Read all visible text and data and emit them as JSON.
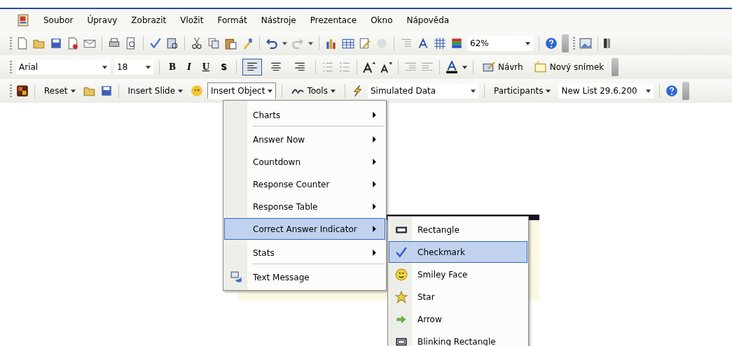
{
  "menu_bar": {
    "items": [
      {
        "label": "Soubor"
      },
      {
        "label": "Úpravy"
      },
      {
        "label": "Zobrazit"
      },
      {
        "label": "Vložit"
      },
      {
        "label": "Formát"
      },
      {
        "label": "Nástroje"
      },
      {
        "label": "Prezentace"
      },
      {
        "label": "Okno"
      },
      {
        "label": "Nápověda"
      }
    ]
  },
  "standard_toolbar": {
    "zoom": "62%"
  },
  "formatting_toolbar": {
    "font": "Arial",
    "font_size": "18",
    "styles": [
      {
        "label": "B",
        "kind": "bold",
        "pressed": false
      },
      {
        "label": "I",
        "kind": "italic",
        "pressed": false
      },
      {
        "label": "U",
        "kind": "underline",
        "pressed": false
      },
      {
        "label": "S",
        "kind": "shadow",
        "pressed": false
      }
    ],
    "alignment": [
      {
        "selected": true
      },
      {
        "selected": false
      },
      {
        "selected": false
      }
    ],
    "buttons": [
      {
        "label": "Návrh",
        "kind": "design"
      },
      {
        "label": "Nový snímek",
        "kind": "new-slide"
      }
    ]
  },
  "session_toolbar": {
    "reset": "Reset",
    "insert_slide": "Insert Slide",
    "insert_object": {
      "label": "Insert Object",
      "open": true
    },
    "tools": "Tools",
    "data_source": "Simulated Data",
    "participants": "Participants",
    "participant_list": "New List 29.6.200"
  },
  "menu": {
    "items": [
      {
        "label": "Charts",
        "has_submenu": true,
        "selected": false,
        "separator_after": true,
        "kind": "plain"
      },
      {
        "label": "Answer Now",
        "has_submenu": true,
        "selected": false,
        "separator_after": false,
        "kind": "plain"
      },
      {
        "label": "Countdown",
        "has_submenu": true,
        "selected": false,
        "separator_after": false,
        "kind": "plain"
      },
      {
        "label": "Response Counter",
        "has_submenu": true,
        "selected": false,
        "separator_after": false,
        "kind": "plain"
      },
      {
        "label": "Response Table",
        "has_submenu": true,
        "selected": false,
        "separator_after": false,
        "kind": "plain"
      },
      {
        "label": "Correct Answer Indicator",
        "has_submenu": true,
        "selected": true,
        "separator_after": false,
        "kind": "plain"
      },
      {
        "label": "Stats",
        "has_submenu": true,
        "selected": false,
        "separator_after": true,
        "kind": "plain"
      },
      {
        "label": "Text Message",
        "has_submenu": false,
        "selected": false,
        "separator_after": false,
        "kind": "message"
      }
    ]
  },
  "submenu": {
    "items": [
      {
        "label": "Rectangle",
        "kind": "rectangle",
        "selected": false
      },
      {
        "label": "Checkmark",
        "kind": "checkmark",
        "selected": true
      },
      {
        "label": "Smiley Face",
        "kind": "smiley",
        "selected": false
      },
      {
        "label": "Star",
        "kind": "star",
        "selected": false
      },
      {
        "label": "Arrow",
        "kind": "arrow",
        "selected": false
      },
      {
        "label": "Blinking Rectangle",
        "kind": "blinking-rectangle",
        "selected": false
      }
    ]
  }
}
